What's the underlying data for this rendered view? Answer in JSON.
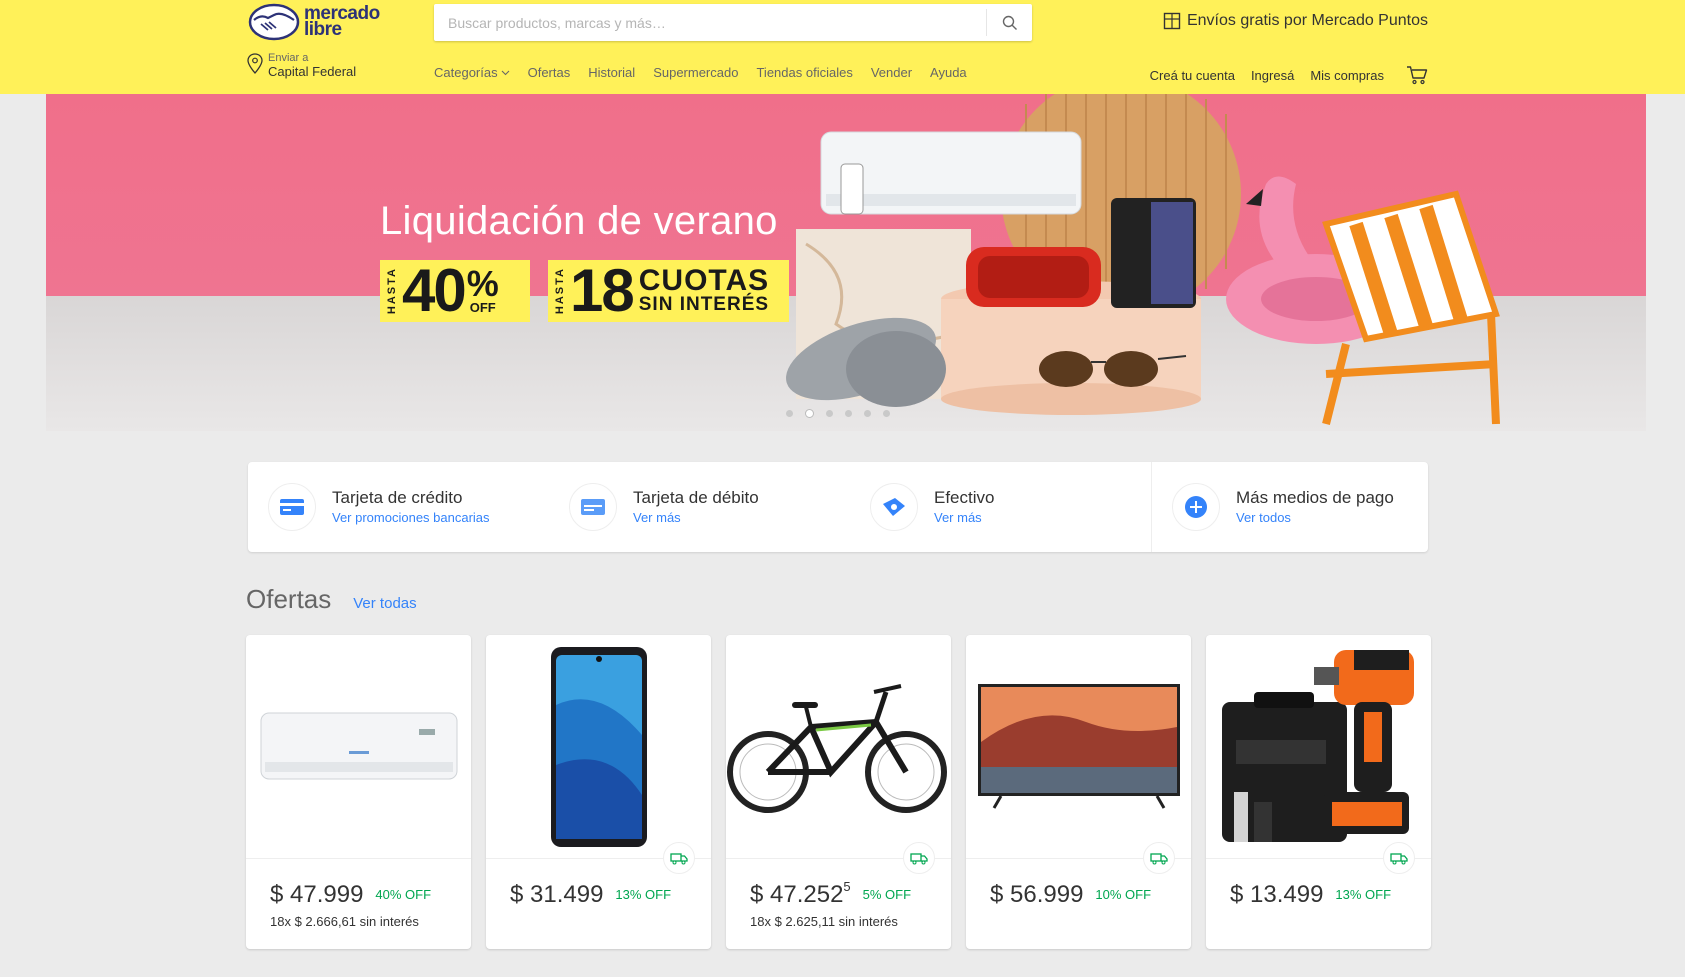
{
  "header": {
    "logo_line1": "mercado",
    "logo_line2": "libre",
    "search_placeholder": "Buscar productos, marcas y más…",
    "promo": "Envíos gratis por Mercado Puntos",
    "location_small": "Enviar a",
    "location": "Capital Federal",
    "nav": [
      "Categorías",
      "Ofertas",
      "Historial",
      "Supermercado",
      "Tiendas oficiales",
      "Vender",
      "Ayuda"
    ],
    "user_nav": [
      "Creá tu cuenta",
      "Ingresá",
      "Mis compras"
    ],
    "colors": {
      "bg": "#fff159",
      "brand": "#2d3277"
    }
  },
  "hero": {
    "title": "Liquidación de verano",
    "badge1": {
      "hasta": "HASTA",
      "number": "40",
      "pct": "%",
      "off": "OFF"
    },
    "badge2": {
      "hasta": "HASTA",
      "number": "18",
      "line1": "CUOTAS",
      "line2": "SIN INTERÉS"
    },
    "slides": 6,
    "active_slide": 2
  },
  "payments": [
    {
      "title": "Tarjeta de crédito",
      "link": "Ver promociones bancarias",
      "icon": "credit-card-icon"
    },
    {
      "title": "Tarjeta de débito",
      "link": "Ver más",
      "icon": "debit-card-icon"
    },
    {
      "title": "Efectivo",
      "link": "Ver más",
      "icon": "cash-icon"
    },
    {
      "title": "Más medios de pago",
      "link": "Ver todos",
      "icon": "plus-icon"
    }
  ],
  "offers": {
    "title": "Ofertas",
    "link": "Ver todas",
    "items": [
      {
        "product": "air-conditioner",
        "price": "$ 47.999",
        "cents": "",
        "discount": "40% OFF",
        "installments": "18x $ 2.666,61 sin interés",
        "free_shipping": false
      },
      {
        "product": "smartphone",
        "price": "$ 31.499",
        "cents": "",
        "discount": "13% OFF",
        "installments": "",
        "free_shipping": true
      },
      {
        "product": "bicycle",
        "price": "$ 47.252",
        "cents": "5",
        "discount": "5% OFF",
        "installments": "18x $ 2.625,11 sin interés",
        "free_shipping": true
      },
      {
        "product": "television",
        "price": "$ 56.999",
        "cents": "",
        "discount": "10% OFF",
        "installments": "",
        "free_shipping": true
      },
      {
        "product": "drill",
        "price": "$ 13.499",
        "cents": "",
        "discount": "13% OFF",
        "installments": "",
        "free_shipping": true
      }
    ]
  }
}
